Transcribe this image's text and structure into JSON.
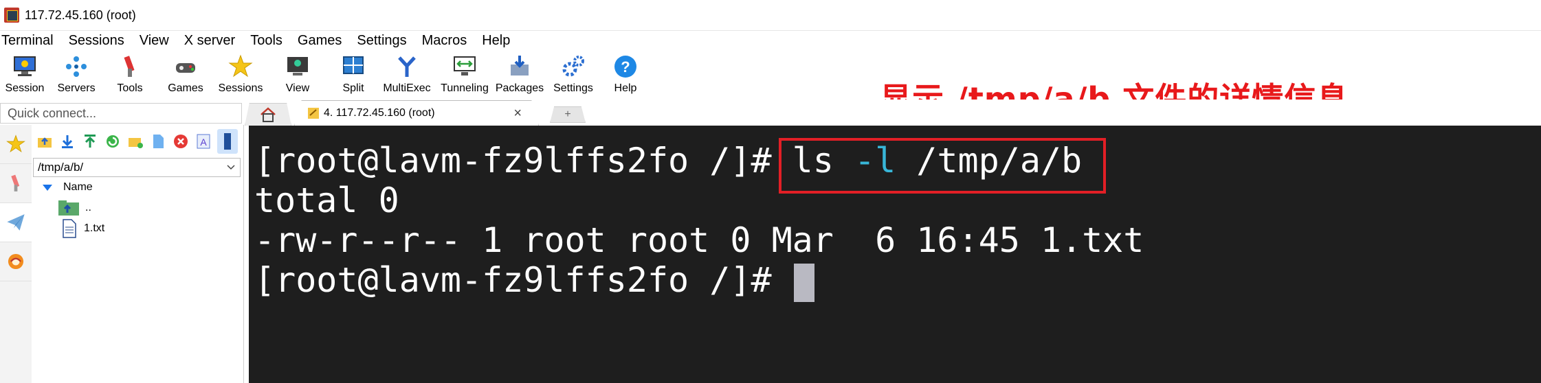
{
  "window": {
    "title": "117.72.45.160 (root)"
  },
  "menu": [
    "Terminal",
    "Sessions",
    "View",
    "X server",
    "Tools",
    "Games",
    "Settings",
    "Macros",
    "Help"
  ],
  "toolbar": [
    {
      "label": "Session",
      "icon": "session-icon"
    },
    {
      "label": "Servers",
      "icon": "servers-icon"
    },
    {
      "label": "Tools",
      "icon": "tools-icon"
    },
    {
      "label": "Games",
      "icon": "games-icon"
    },
    {
      "label": "Sessions",
      "icon": "star-icon"
    },
    {
      "label": "View",
      "icon": "view-icon"
    },
    {
      "label": "Split",
      "icon": "split-icon"
    },
    {
      "label": "MultiExec",
      "icon": "multiexec-icon"
    },
    {
      "label": "Tunneling",
      "icon": "tunneling-icon"
    },
    {
      "label": "Packages",
      "icon": "packages-icon"
    },
    {
      "label": "Settings",
      "icon": "settings-icon"
    },
    {
      "label": "Help",
      "icon": "help-icon"
    }
  ],
  "annotation": "显示 /tmp/a/b 文件的详情信息",
  "quick_connect": {
    "placeholder": "Quick connect..."
  },
  "sftp": {
    "path": "/tmp/a/b/",
    "column_name": "Name",
    "items": [
      {
        "name": "..",
        "icon": "parent-folder-icon"
      },
      {
        "name": "1.txt",
        "icon": "file-icon"
      }
    ]
  },
  "tabs": {
    "active": "4. 117.72.45.160 (root)",
    "close": "×",
    "new": "+"
  },
  "terminal": {
    "prompt": "[root@lavm-fz9lffs2fo /]# ",
    "cmd_ls": "ls ",
    "cmd_opt": "-l",
    "cmd_path": " /tmp/a/b",
    "line2": "total 0",
    "line3": "-rw-r--r-- 1 root root 0 Mar  6 16:45 1.txt"
  },
  "colors": {
    "terminal_bg": "#1e1e1e",
    "annotation": "#e8191b",
    "option_text": "#38b6d8",
    "highlight_border": "#e21f26"
  }
}
